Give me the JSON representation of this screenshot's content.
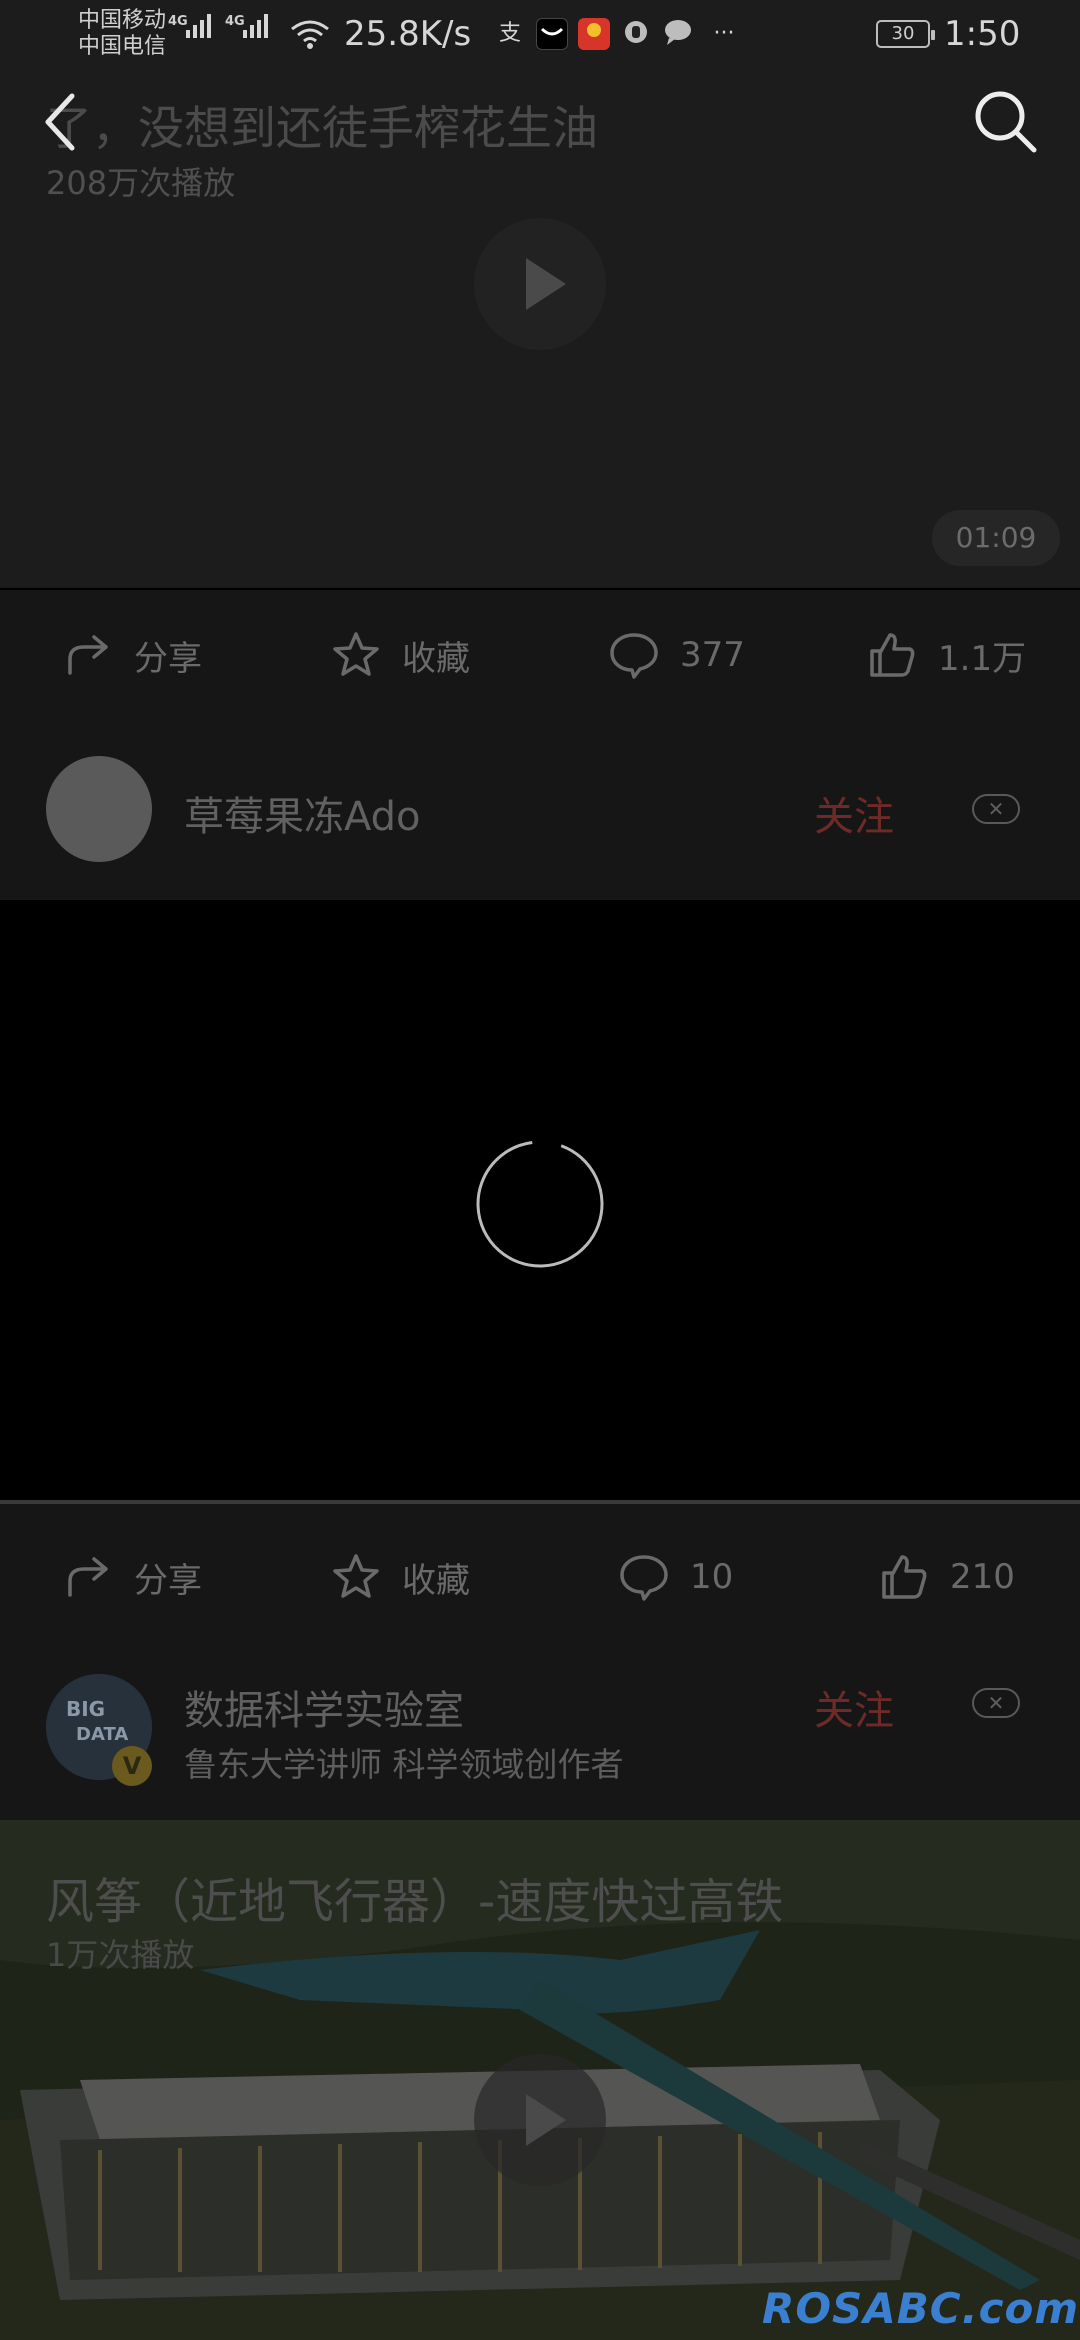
{
  "status_bar": {
    "carrier_1": "中国移动",
    "carrier_2": "中国电信",
    "net_1": "4G",
    "net_2": "4G",
    "speed": "25.8K/s",
    "battery": "30",
    "time": "1:50",
    "more": "···",
    "alipay_glyph": "支"
  },
  "video_1": {
    "title": "了，没想到还徒手榨花生油",
    "views": "208万次播放",
    "duration": "01:09"
  },
  "actions_1": {
    "share": "分享",
    "favorite": "收藏",
    "comments": "377",
    "likes": "1.1万"
  },
  "author_1": {
    "name": "草莓果冻Ado",
    "follow": "关注"
  },
  "actions_2": {
    "share": "分享",
    "favorite": "收藏",
    "comments": "10",
    "likes": "210"
  },
  "author_2": {
    "name": "数据科学实验室",
    "description": "鲁东大学讲师 科学领域创作者",
    "follow": "关注",
    "avatar_text_1": "BIG",
    "avatar_text_2": "DATA",
    "verified_badge": "V"
  },
  "video_2": {
    "title": "风筝（近地飞行器）-速度快过高铁",
    "views": "1万次播放"
  },
  "watermark": "ROSABC.com",
  "colors": {
    "follow": "#6e2a26",
    "watermark": "#3b7fd0",
    "panel": "#161616"
  }
}
